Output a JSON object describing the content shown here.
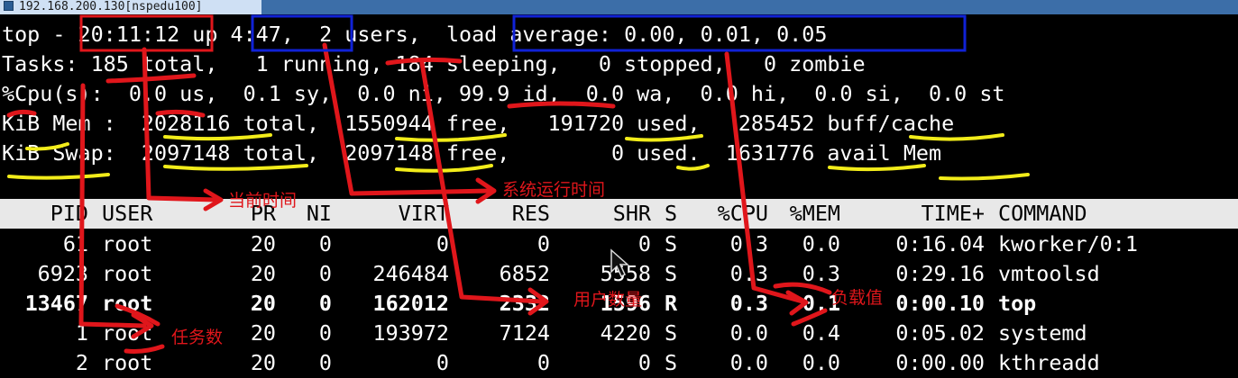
{
  "window": {
    "tab_title": "192.168.200.130[nspedu100]"
  },
  "summary": {
    "line1": {
      "prefix": "top - ",
      "time": "20:11:12",
      "up_label": " up ",
      "uptime": "4:47,",
      "users": "  2 users,  ",
      "load": "load average: 0.00, 0.01, 0.05"
    },
    "line2": "Tasks: 185 total,   1 running, 184 sleeping,   0 stopped,   0 zombie",
    "line3": "%Cpu(s):  0.0 us,  0.1 sy,  0.0 ni, 99.9 id,  0.0 wa,  0.0 hi,  0.0 si,  0.0 st",
    "line4": "KiB Mem :  2028116 total,  1550944 free,   191720 used,   285452 buff/cache",
    "line5": "KiB Swap:  2097148 total,  2097148 free,        0 used.  1631776 avail Mem"
  },
  "table": {
    "headers": [
      "PID",
      "USER",
      "PR",
      "NI",
      "VIRT",
      "RES",
      "SHR",
      "S",
      "%CPU",
      "%MEM",
      "TIME+",
      "COMMAND"
    ],
    "rows": [
      {
        "pid": "61",
        "user": "root",
        "pr": "20",
        "ni": "0",
        "virt": "0",
        "res": "0",
        "shr": "0",
        "s": "S",
        "cpu": "0.3",
        "mem": "0.0",
        "time": "0:16.04",
        "cmd": "kworker/0:1"
      },
      {
        "pid": "6923",
        "user": "root",
        "pr": "20",
        "ni": "0",
        "virt": "246484",
        "res": "6852",
        "shr": "5558",
        "s": "S",
        "cpu": "0.3",
        "mem": "0.3",
        "time": "0:29.16",
        "cmd": "vmtoolsd"
      },
      {
        "pid": "13467",
        "user": "root",
        "pr": "20",
        "ni": "0",
        "virt": "162012",
        "res": "2332",
        "shr": "1596",
        "s": "R",
        "cpu": "0.3",
        "mem": "0.1",
        "time": "0:00.10",
        "cmd": "top"
      },
      {
        "pid": "1",
        "user": "root",
        "pr": "20",
        "ni": "0",
        "virt": "193972",
        "res": "7124",
        "shr": "4220",
        "s": "S",
        "cpu": "0.0",
        "mem": "0.4",
        "time": "0:05.02",
        "cmd": "systemd"
      },
      {
        "pid": "2",
        "user": "root",
        "pr": "20",
        "ni": "0",
        "virt": "0",
        "res": "0",
        "shr": "0",
        "s": "S",
        "cpu": "0.0",
        "mem": "0.0",
        "time": "0:00.00",
        "cmd": "kthreadd"
      }
    ]
  },
  "annotations": {
    "current_time": "当前时间",
    "uptime": "系统运行时间",
    "tasks": "任务数",
    "memory": "用户数量",
    "load": "负载值"
  },
  "colors": {
    "red_ink": "#e0161b",
    "blue_box": "#1022d6",
    "yellow_mark": "#f2ec1a"
  }
}
